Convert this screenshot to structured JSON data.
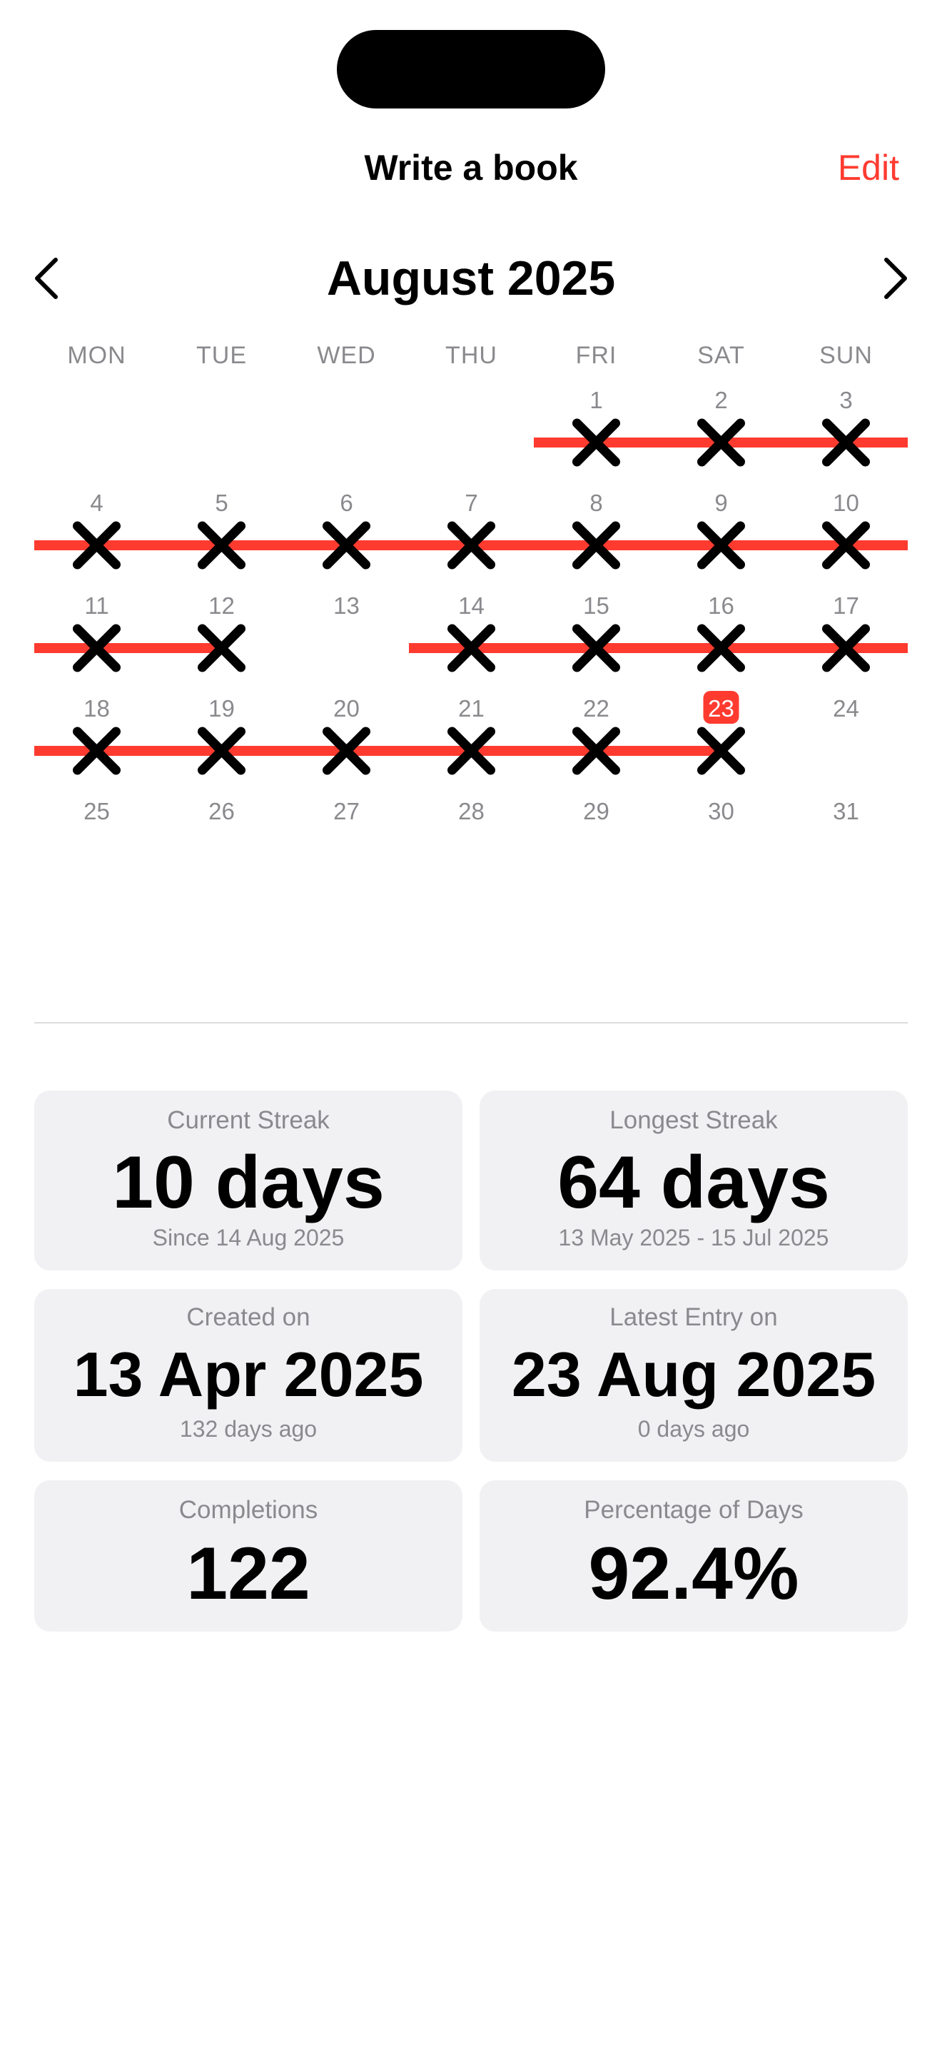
{
  "nav": {
    "title": "Write a book",
    "edit_label": "Edit"
  },
  "calendar": {
    "month_title": "August 2025",
    "prev_icon": "chevron-left-icon",
    "next_icon": "chevron-right-icon",
    "weekdays": [
      "MON",
      "TUE",
      "WED",
      "THU",
      "FRI",
      "SAT",
      "SUN"
    ],
    "first_weekday_index": 4,
    "days_in_month": 31,
    "today": 23,
    "completed_days": [
      1,
      2,
      3,
      4,
      5,
      6,
      7,
      8,
      9,
      10,
      11,
      12,
      14,
      15,
      16,
      17,
      18,
      19,
      20,
      21,
      22,
      23
    ],
    "mark_icon": "cross-mark-icon",
    "colors": {
      "streak_line": "#ff3b30",
      "today_badge": "#ff3b30",
      "mark": "#000000",
      "day_number": "#8a8a8e"
    }
  },
  "stats": {
    "current_streak": {
      "label": "Current Streak",
      "value": "10 days",
      "sub": "Since 14 Aug 2025"
    },
    "longest_streak": {
      "label": "Longest Streak",
      "value": "64 days",
      "sub": "13 May 2025 - 15 Jul 2025"
    },
    "created_on": {
      "label": "Created on",
      "value": "13 Apr 2025",
      "sub": "132 days ago"
    },
    "latest_entry": {
      "label": "Latest Entry on",
      "value": "23 Aug 2025",
      "sub": "0 days ago"
    },
    "completions": {
      "label": "Completions",
      "value": "122"
    },
    "percentage": {
      "label": "Percentage of Days",
      "value": "92.4%"
    }
  },
  "accent_color": "#ff3b30"
}
